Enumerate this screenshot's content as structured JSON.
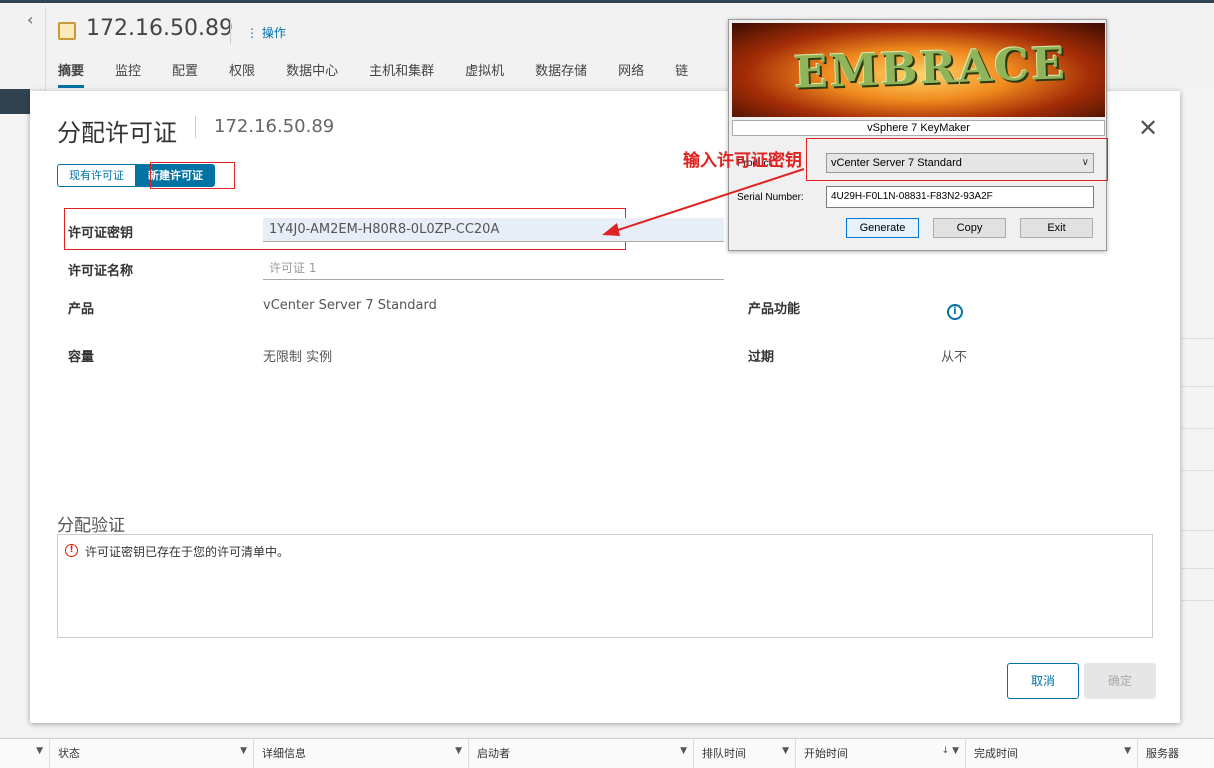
{
  "background": {
    "host_title": "172.16.50.89",
    "actions_label": "操作",
    "tabs": [
      "摘要",
      "监控",
      "配置",
      "权限",
      "数据中心",
      "主机和集群",
      "虚拟机",
      "数据存储",
      "网络",
      "链"
    ],
    "footer_columns": [
      "状态",
      "详细信息",
      "启动者",
      "排队时间",
      "开始时间",
      "完成时间",
      "服务器"
    ]
  },
  "modal": {
    "title": "分配许可证",
    "host": "172.16.50.89",
    "seg_existing": "现有许可证",
    "seg_new": "新建许可证",
    "key_label": "许可证密钥",
    "key_value": "1Y4J0-AM2EM-H80R8-0L0ZP-CC20A",
    "name_label": "许可证名称",
    "name_placeholder": "许可证 1",
    "product_label": "产品",
    "product_value": "vCenter Server 7 Standard",
    "features_label": "产品功能",
    "capacity_label": "容量",
    "capacity_value": "无限制 实例",
    "expiry_label": "过期",
    "expiry_value": "从不",
    "validation_title": "分配验证",
    "validation_message": "许可证密钥已存在于您的许可清单中。",
    "cancel_label": "取消",
    "ok_label": "确定"
  },
  "keymaker": {
    "logo_text": "EMBRACE",
    "caption": "vSphere 7 KeyMaker",
    "product_label": "Product:",
    "product_value": "vCenter Server 7 Standard",
    "serial_label": "Serial Number:",
    "serial_value": "4U29H-F0L1N-08831-F83N2-93A2F",
    "btn_generate": "Generate",
    "btn_copy": "Copy",
    "btn_exit": "Exit"
  },
  "annotation": {
    "text": "输入许可证密钥",
    "color": "#e02222"
  }
}
